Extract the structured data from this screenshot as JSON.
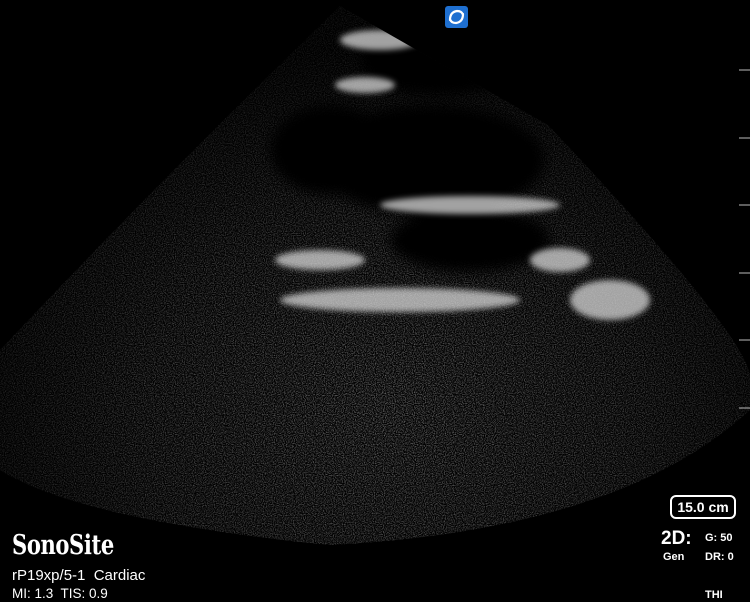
{
  "brand": "SonoSite",
  "probe_info": "rP19xp/5-1  Cardiac",
  "safety_indices": "MI: 1.3  TIS: 0.9",
  "depth": "15.0 cm",
  "mode": "2D:",
  "preset": "Gen",
  "gain": "G: 50",
  "dynamic_range": "DR: 0",
  "imaging_option": "THI",
  "icons": {
    "top_badge": "sonosite-logo-icon"
  },
  "colors": {
    "background": "#000000",
    "badge": "#1e6fd0",
    "text": "#ffffff"
  }
}
